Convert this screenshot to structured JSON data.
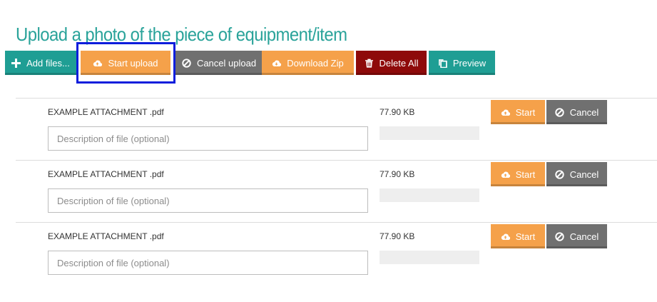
{
  "page_title": "Upload a photo of the piece of equipment/item",
  "toolbar": {
    "add_files": "Add files...",
    "start_upload": "Start upload",
    "cancel_upload": "Cancel upload",
    "download_zip": "Download Zip",
    "delete_all": "Delete All",
    "preview": "Preview"
  },
  "files": [
    {
      "name": "EXAMPLE ATTACHMENT .pdf",
      "size": "77.90 KB",
      "description_placeholder": "Description of file (optional)",
      "description_value": "",
      "progress": 0,
      "start_label": "Start",
      "cancel_label": "Cancel"
    },
    {
      "name": "EXAMPLE ATTACHMENT .pdf",
      "size": "77.90 KB",
      "description_placeholder": "Description of file (optional)",
      "description_value": "",
      "progress": 0,
      "start_label": "Start",
      "cancel_label": "Cancel"
    },
    {
      "name": "EXAMPLE ATTACHMENT .pdf",
      "size": "77.90 KB",
      "description_placeholder": "Description of file (optional)",
      "description_value": "",
      "progress": 0,
      "start_label": "Start",
      "cancel_label": "Cancel"
    }
  ],
  "colors": {
    "title": "#2aa39a",
    "teal": "#1f9e94",
    "orange": "#f5a14a",
    "gray": "#707070",
    "danger": "#8e0a0a",
    "highlight": "#0c1ddc"
  },
  "icons": {
    "add_files": "plus-icon",
    "start_upload": "cloud-upload-icon",
    "cancel_upload": "ban-icon",
    "download_zip": "cloud-download-icon",
    "delete_all": "trash-icon",
    "preview": "copy-icon"
  }
}
